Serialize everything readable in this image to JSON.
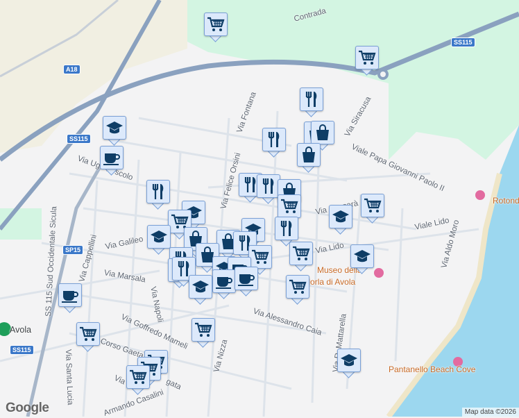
{
  "map": {
    "labels": [
      "Contrada",
      "Via Fontana",
      "Via Siracusa",
      "Viale Papa Giovanni Paolo II",
      "Via Cassarà",
      "Viale Lido",
      "Via Aldo Moro",
      "Via Ugo Foscolo",
      "SS 115 Sud Occidentale Sicula",
      "Via Galileo",
      "Via Marsala",
      "Via Cappellini",
      "Via Napoli",
      "Via Goffredo Mameli",
      "Corso Gaeta",
      "Via Santa Lucia",
      "Via Nizza",
      "Via Alessandro Caia",
      "Via Felice Orsini",
      "Via R. Mattarella",
      "Via Lido",
      "Via Sem",
      "Armando Casalini",
      "gata"
    ],
    "pois": [
      "Museo della",
      "Mandorla di Avola",
      "Rotonda",
      "Pantanello Beach Cove"
    ],
    "places": [
      "Avola"
    ],
    "shields": [
      "SS115",
      "SS115",
      "SS115",
      "SP15",
      "A18"
    ],
    "marker_types": [
      "cart-icon",
      "restaurant-icon",
      "school-icon",
      "cafe-icon",
      "shopping-bag-icon"
    ]
  },
  "footer": {
    "logo": "Google",
    "attribution": "Map data ©2026"
  },
  "colors": {
    "land": "#f3f3f4",
    "park": "#d3f5e2",
    "water": "#9cd7ef",
    "road": "#8aa1bf",
    "marker_icon": "#0e3d66"
  }
}
